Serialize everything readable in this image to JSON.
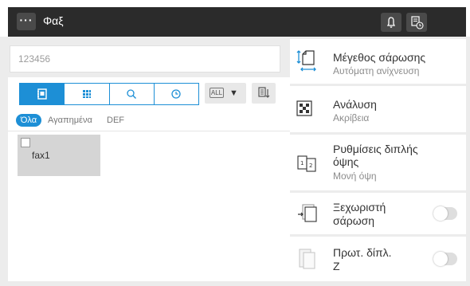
{
  "header": {
    "title": "Φαξ",
    "menu_label": "···"
  },
  "destination_input": {
    "value": "123456"
  },
  "filter": {
    "all_badge": "ALL",
    "caret": "▼"
  },
  "chips": [
    {
      "label": "Όλα",
      "selected": true
    },
    {
      "label": "Αγαπημένα"
    },
    {
      "label": "DEF"
    }
  ],
  "entries": [
    {
      "name": "fax1",
      "checked": false
    }
  ],
  "settings": {
    "scan_size": {
      "label": "Μέγεθος σάρωσης",
      "value": "Αυτόματη ανίχνευση"
    },
    "resolution": {
      "label": "Ανάλυση",
      "value": "Ακρίβεια"
    },
    "duplex": {
      "label_line1": "Ρυθμίσεις διπλής",
      "label_line2": "όψης",
      "value": "Μονή όψη"
    },
    "separate_scan": {
      "label_line1": "Ξεχωριστή",
      "label_line2": "σάρωση",
      "enabled": false
    },
    "z_fold": {
      "label_line1": "Πρωτ. δίπλ.",
      "label_line2": "Z",
      "enabled": false
    }
  },
  "colors": {
    "accent": "#1d8fd6",
    "topbar": "#2b2b2b",
    "panel_bg": "#ececec"
  }
}
